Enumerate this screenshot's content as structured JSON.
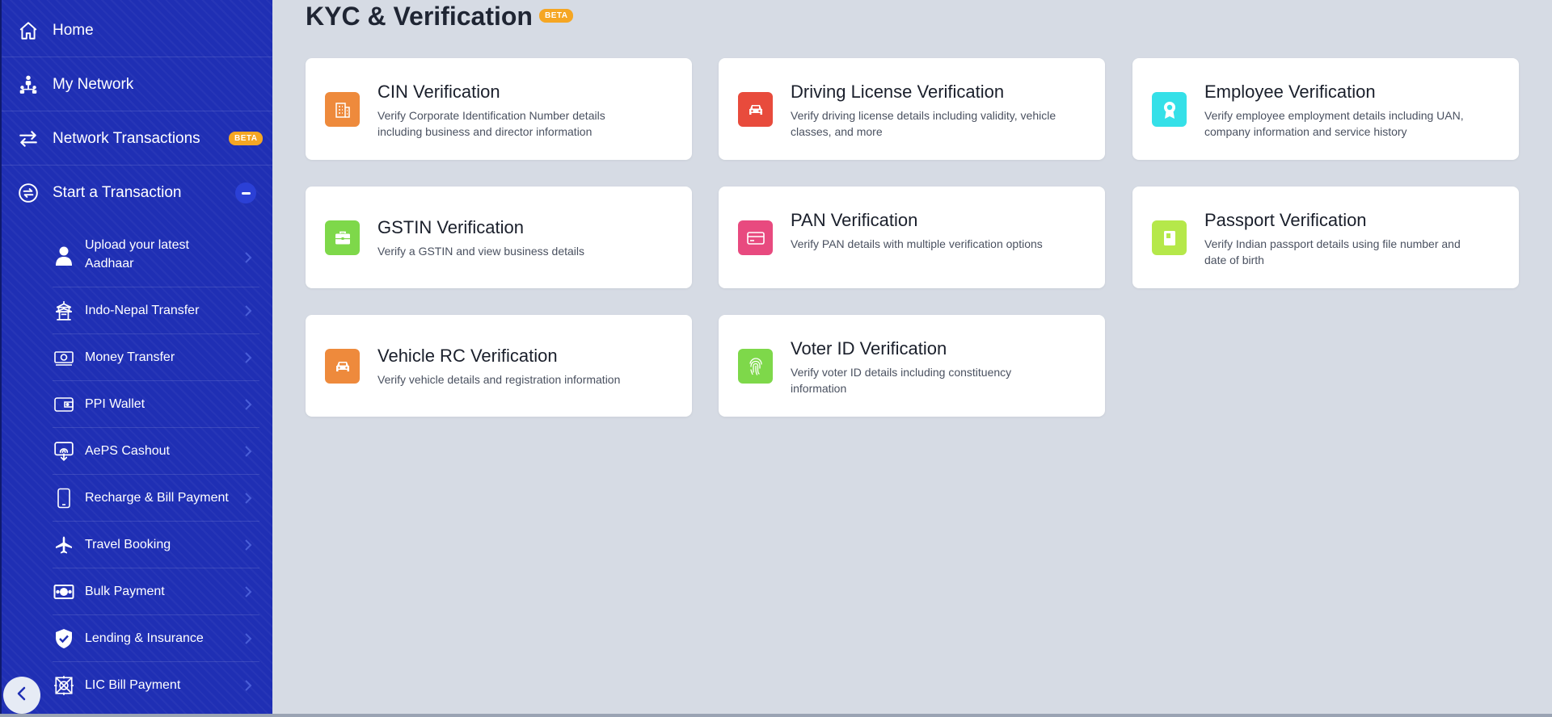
{
  "sidebar": {
    "home_label": "Home",
    "network_label": "My Network",
    "network_tx_label": "Network Transactions",
    "network_tx_badge": "BETA",
    "start_tx_label": "Start a Transaction",
    "sub_items": [
      {
        "label": "Upload your latest Aadhaar",
        "icon": "user-icon"
      },
      {
        "label": "Indo-Nepal Transfer",
        "icon": "temple-icon"
      },
      {
        "label": "Money Transfer",
        "icon": "cash-icon"
      },
      {
        "label": "PPI Wallet",
        "icon": "wallet-icon"
      },
      {
        "label": "AePS Cashout",
        "icon": "fingerprint-cashout-icon"
      },
      {
        "label": "Recharge & Bill Payment",
        "icon": "mobile-icon"
      },
      {
        "label": "Travel Booking",
        "icon": "airplane-icon"
      },
      {
        "label": "Bulk Payment",
        "icon": "banknote-icon"
      },
      {
        "label": "Lending & Insurance",
        "icon": "shield-check-icon"
      },
      {
        "label": "LIC Bill Payment",
        "icon": "lic-icon"
      }
    ]
  },
  "main": {
    "title": "KYC & Verification",
    "title_badge": "BETA",
    "cards": [
      {
        "title": "CIN Verification",
        "desc": "Verify Corporate Identification Number details including business and director information",
        "icon": "building-icon",
        "color": "#ee8a3c"
      },
      {
        "title": "Driving License Verification",
        "desc": "Verify driving license details including validity, vehicle classes, and more",
        "icon": "car-icon",
        "color": "#e84b3c"
      },
      {
        "title": "Employee Verification",
        "desc": "Verify employee employment details including UAN, company information and service history",
        "icon": "award-icon",
        "color": "#35e0e8"
      },
      {
        "title": "GSTIN Verification",
        "desc": "Verify a GSTIN and view business details",
        "icon": "briefcase-icon",
        "color": "#7ed84a"
      },
      {
        "title": "PAN Verification",
        "desc": "Verify PAN details with multiple verification options",
        "icon": "card-icon",
        "color": "#e84a7f"
      },
      {
        "title": "Passport Verification",
        "desc": "Verify Indian passport details using file number and date of birth",
        "icon": "passport-icon",
        "color": "#b5e84a"
      },
      {
        "title": "Vehicle RC Verification",
        "desc": "Verify vehicle details and registration information",
        "icon": "car-icon",
        "color": "#ee8a3c"
      },
      {
        "title": "Voter ID Verification",
        "desc": "Verify voter ID details including constituency information",
        "icon": "fingerprint-icon",
        "color": "#7ed84a"
      }
    ]
  },
  "colors": {
    "sidebar_bg": "#1f2fb4",
    "page_bg": "#d6dbe4",
    "badge": "#f5a623"
  }
}
